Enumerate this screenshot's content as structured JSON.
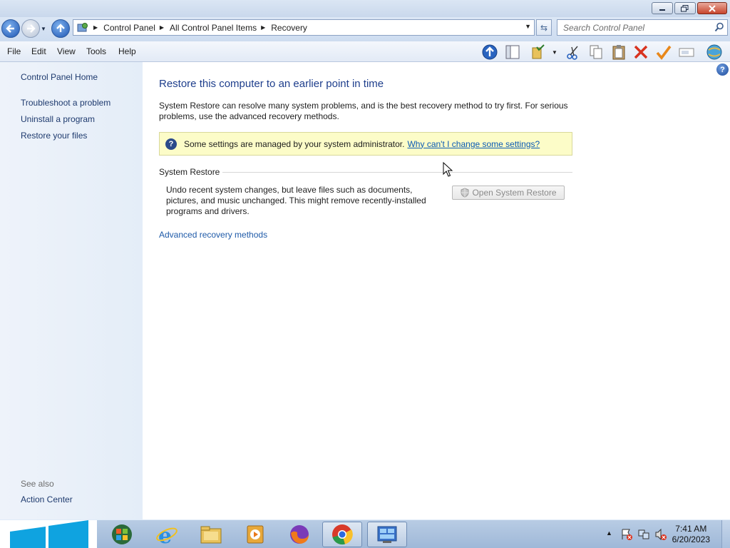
{
  "window": {
    "minimize_icon": "minimize-icon",
    "maximize_icon": "restore-icon",
    "close_icon": "close-icon"
  },
  "address": {
    "breadcrumbs": [
      "Control Panel",
      "All Control Panel Items",
      "Recovery"
    ],
    "search_placeholder": "Search Control Panel"
  },
  "menu": {
    "file": "File",
    "edit": "Edit",
    "view": "View",
    "tools": "Tools",
    "help": "Help"
  },
  "sidebar": {
    "home": "Control Panel Home",
    "items": [
      "Troubleshoot a problem",
      "Uninstall a program",
      "Restore your files"
    ],
    "see_also_label": "See also",
    "see_also_items": [
      "Action Center"
    ]
  },
  "main": {
    "title": "Restore this computer to an earlier point in time",
    "intro": "System Restore can resolve many system problems, and is the best recovery method to try first. For serious problems, use the advanced recovery methods.",
    "info_text": "Some settings are managed by your system administrator.",
    "info_link": "Why can't I change some settings?",
    "section_title": "System Restore",
    "section_desc": "Undo recent system changes, but leave files such as documents, pictures, and music unchanged. This might remove recently-installed programs and drivers.",
    "open_restore_button": "Open System Restore",
    "advanced_link": "Advanced recovery methods"
  },
  "taskbar": {
    "time": "7:41 AM",
    "date": "6/20/2023"
  },
  "colors": {
    "title_blue": "#1e3e8c",
    "link_blue": "#0a5ab4",
    "info_yellow": "#fcfcc8"
  }
}
